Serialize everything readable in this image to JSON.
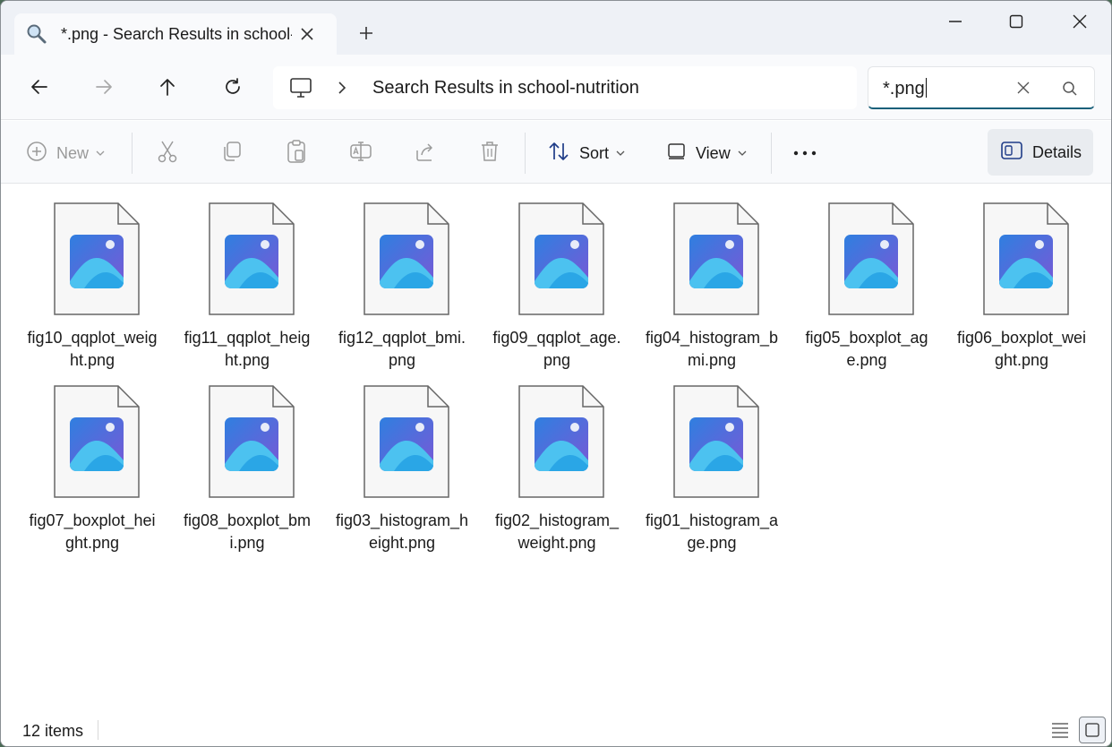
{
  "tab": {
    "icon": "search-icon",
    "title": "*.png - Search Results in school-nutrition"
  },
  "window_controls": [
    "minimize-icon",
    "maximize-icon",
    "close-icon"
  ],
  "address_bar": {
    "root_icon": "computer-icon",
    "path": "Search Results in school-nutrition"
  },
  "search": {
    "value": "*.png"
  },
  "command_bar": {
    "new_label": "New",
    "sort_label": "Sort",
    "view_label": "View",
    "details_label": "Details"
  },
  "files": [
    {
      "name": "fig10_qqplot_weight.png"
    },
    {
      "name": "fig11_qqplot_height.png"
    },
    {
      "name": "fig12_qqplot_bmi.png"
    },
    {
      "name": "fig09_qqplot_age.png"
    },
    {
      "name": "fig04_histogram_bmi.png"
    },
    {
      "name": "fig05_boxplot_age.png"
    },
    {
      "name": "fig06_boxplot_weight.png"
    },
    {
      "name": "fig07_boxplot_height.png"
    },
    {
      "name": "fig08_boxplot_bmi.png"
    },
    {
      "name": "fig03_histogram_height.png"
    },
    {
      "name": "fig02_histogram_weight.png"
    },
    {
      "name": "fig01_histogram_age.png"
    }
  ],
  "status": {
    "item_count": "12 items"
  },
  "colors": {
    "accent": "#19607a",
    "image_icon_blue": "#2f7fe0",
    "image_icon_purple": "#7a58d6"
  }
}
